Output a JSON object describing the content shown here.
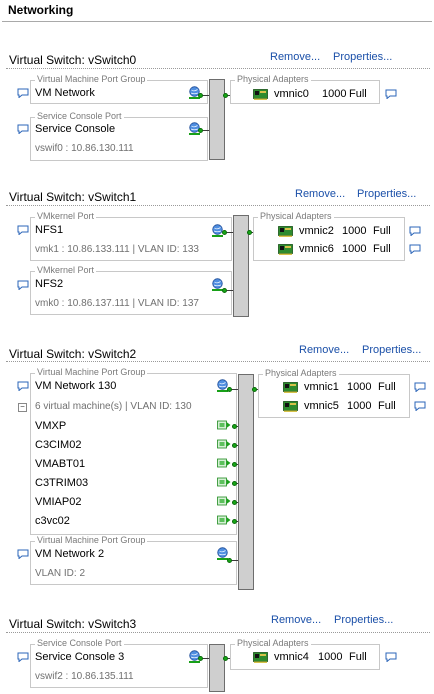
{
  "header": {
    "title": "Networking"
  },
  "actions": {
    "remove": "Remove...",
    "properties": "Properties..."
  },
  "captions": {
    "vm_port_group": "Virtual Machine Port Group",
    "service_console_port": "Service Console Port",
    "vmkernel_port": "VMkernel Port",
    "physical_adapters": "Physical Adapters"
  },
  "vswitch0": {
    "title": "Virtual Switch: vSwitch0",
    "groups": [
      {
        "name": "VM Network"
      },
      {
        "name": "Service Console",
        "detail": "vswif0 : 10.86.130.111"
      }
    ],
    "adapters": [
      {
        "name": "vmnic0",
        "speed": "1000",
        "duplex": "Full"
      }
    ]
  },
  "vswitch1": {
    "title": "Virtual Switch: vSwitch1",
    "groups": [
      {
        "name": "NFS1",
        "detail": "vmk1 : 10.86.133.111 | VLAN ID: 133"
      },
      {
        "name": "NFS2",
        "detail": "vmk0 : 10.86.137.111 | VLAN ID: 137"
      }
    ],
    "adapters": [
      {
        "name": "vmnic2",
        "speed": "1000",
        "duplex": "Full"
      },
      {
        "name": "vmnic6",
        "speed": "1000",
        "duplex": "Full"
      }
    ]
  },
  "vswitch2": {
    "title": "Virtual Switch: vSwitch2",
    "groups": [
      {
        "name": "VM Network 130",
        "detail": "6 virtual machine(s) | VLAN ID: 130",
        "vms": [
          "VMXP",
          "C3CIM02",
          "VMABT01",
          "C3TRIM03",
          "VMIAP02",
          "c3vc02"
        ]
      },
      {
        "name": "VM Network 2",
        "detail": "VLAN ID: 2"
      }
    ],
    "adapters": [
      {
        "name": "vmnic1",
        "speed": "1000",
        "duplex": "Full"
      },
      {
        "name": "vmnic5",
        "speed": "1000",
        "duplex": "Full"
      }
    ]
  },
  "vswitch3": {
    "title": "Virtual Switch: vSwitch3",
    "groups": [
      {
        "name": "Service Console 3",
        "detail": "vswif2 : 10.86.135.111"
      }
    ],
    "adapters": [
      {
        "name": "vmnic4",
        "speed": "1000",
        "duplex": "Full"
      }
    ]
  }
}
